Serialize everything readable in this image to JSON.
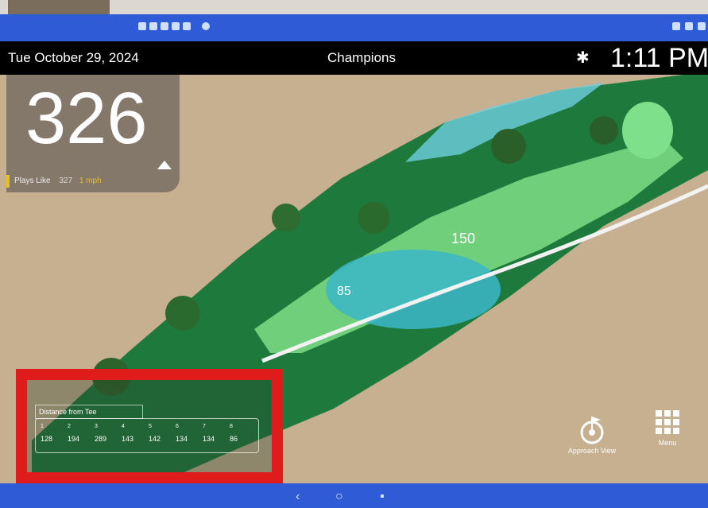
{
  "header": {
    "date": "Tue October 29, 2024",
    "course": "Champions",
    "time": "1:11 PM"
  },
  "distance_card": {
    "distance": "326",
    "plays_like_label": "Plays Like",
    "plays_like_value": "327",
    "plays_like_unit": "1 mph"
  },
  "hole_markers": {
    "marker_150": "150",
    "marker_85": "85"
  },
  "distance_from_tee": {
    "title": "Distance from Tee",
    "indexes": [
      "1",
      "2",
      "3",
      "4",
      "5",
      "6",
      "7",
      "8"
    ],
    "values": [
      "128",
      "194",
      "289",
      "143",
      "142",
      "134",
      "134",
      "86"
    ]
  },
  "buttons": {
    "approach_view": "Approach View",
    "menu": "Menu"
  },
  "colors": {
    "system_blue": "#2f5bd6",
    "header_black": "#000000",
    "accent_red": "#e01b1b",
    "plays_like_yellow": "#e6c11b",
    "fairway_green": "#6fcf7a"
  }
}
